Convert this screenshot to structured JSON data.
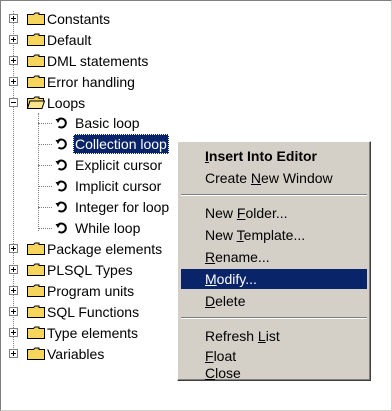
{
  "tree": {
    "folders_top": [
      {
        "label": "Constants",
        "expanded": false
      },
      {
        "label": "Default",
        "expanded": false
      },
      {
        "label": "DML statements",
        "expanded": false
      },
      {
        "label": "Error handling",
        "expanded": false
      },
      {
        "label": "Loops",
        "expanded": true
      }
    ],
    "loop_items": [
      {
        "label": "Basic loop",
        "selected": false
      },
      {
        "label": "Collection loop",
        "selected": true
      },
      {
        "label": "Explicit cursor",
        "selected": false
      },
      {
        "label": "Implicit cursor",
        "selected": false
      },
      {
        "label": "Integer for loop",
        "selected": false
      },
      {
        "label": "While loop",
        "selected": false
      }
    ],
    "folders_bottom": [
      {
        "label": "Package elements",
        "expanded": false
      },
      {
        "label": "PLSQL Types",
        "expanded": false
      },
      {
        "label": "Program units",
        "expanded": false
      },
      {
        "label": "SQL Functions",
        "expanded": false
      },
      {
        "label": "Type elements",
        "expanded": false
      },
      {
        "label": "Variables",
        "expanded": false
      }
    ]
  },
  "context_menu": {
    "items": [
      {
        "pre": "",
        "u": "I",
        "post": "nsert Into Editor",
        "bold": true,
        "hover": false
      },
      {
        "pre": "Create ",
        "u": "N",
        "post": "ew Window",
        "bold": false,
        "hover": false
      },
      {
        "pre": "New ",
        "u": "F",
        "post": "older...",
        "bold": false,
        "hover": false
      },
      {
        "pre": "New ",
        "u": "T",
        "post": "emplate...",
        "bold": false,
        "hover": false
      },
      {
        "pre": "",
        "u": "R",
        "post": "ename...",
        "bold": false,
        "hover": false
      },
      {
        "pre": "",
        "u": "M",
        "post": "odify...",
        "bold": false,
        "hover": true
      },
      {
        "pre": "",
        "u": "D",
        "post": "elete",
        "bold": false,
        "hover": false
      },
      {
        "pre": "Refresh ",
        "u": "L",
        "post": "ist",
        "bold": false,
        "hover": false
      },
      {
        "pre": "",
        "u": "F",
        "post": "loat",
        "bold": false,
        "hover": false
      },
      {
        "pre": "",
        "u": "C",
        "post": "lose",
        "bold": false,
        "hover": false
      }
    ]
  },
  "colors": {
    "selection": "#0a246a",
    "menu_bg": "#d4d0c8",
    "folder": "#f6d55c"
  },
  "icons": {
    "folder": "folder-icon",
    "snippet": "loop-snippet-icon",
    "expand": "plus-box-icon",
    "collapse": "minus-box-icon"
  }
}
